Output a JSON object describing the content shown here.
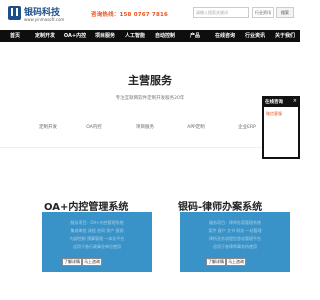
{
  "header": {
    "brand_name": "银码科技",
    "brand_url": "www.yinmasoft.com",
    "hotline": "咨询热线：158 0767 7816",
    "search_placeholder": "请输入搜索关键词",
    "search_scope": "行业资讯",
    "search_button": "搜索"
  },
  "nav": {
    "items": [
      "首页",
      "定制开发",
      "OA+内控",
      "项目服务",
      "人工智能",
      "自动控制",
      "产品",
      "在线咨询",
      "行业资讯",
      "关于我们"
    ]
  },
  "services": {
    "title": "主营服务",
    "subtitle": "专注互联网软件定制开发服务20年",
    "items": [
      "定制开发",
      "OA内控",
      "项目服务",
      "APP定制",
      "企业ERP"
    ]
  },
  "side_panel": {
    "title": "在线咨询",
    "close": "×",
    "link": "微信客服"
  },
  "cards": [
    {
      "title": "OA+内控管理系统",
      "lines": [
        "服务项目：OA+内控管理系统",
        "集成审批 流程 合同 资产 报销",
        "内部控制 预算管理 一体化平台",
        "适用于各行政事业单位使用"
      ],
      "btn1": "了解详情",
      "btn2": "马上咨询"
    },
    {
      "title": "银码-律师办案系统",
      "lines": [
        "服务项目：律师办案管理系统",
        "案件 客户 文书 财务 一站管理",
        "律所业务流程信息化管理平台",
        "适用于各律师事务所使用"
      ],
      "btn1": "了解详情",
      "btn2": "马上咨询"
    }
  ],
  "colors": {
    "brand_blue": "#1d4f8c",
    "hotline_orange": "#e8541e",
    "nav_black": "#0e0e0e",
    "card_blue": "#3a93c8"
  }
}
